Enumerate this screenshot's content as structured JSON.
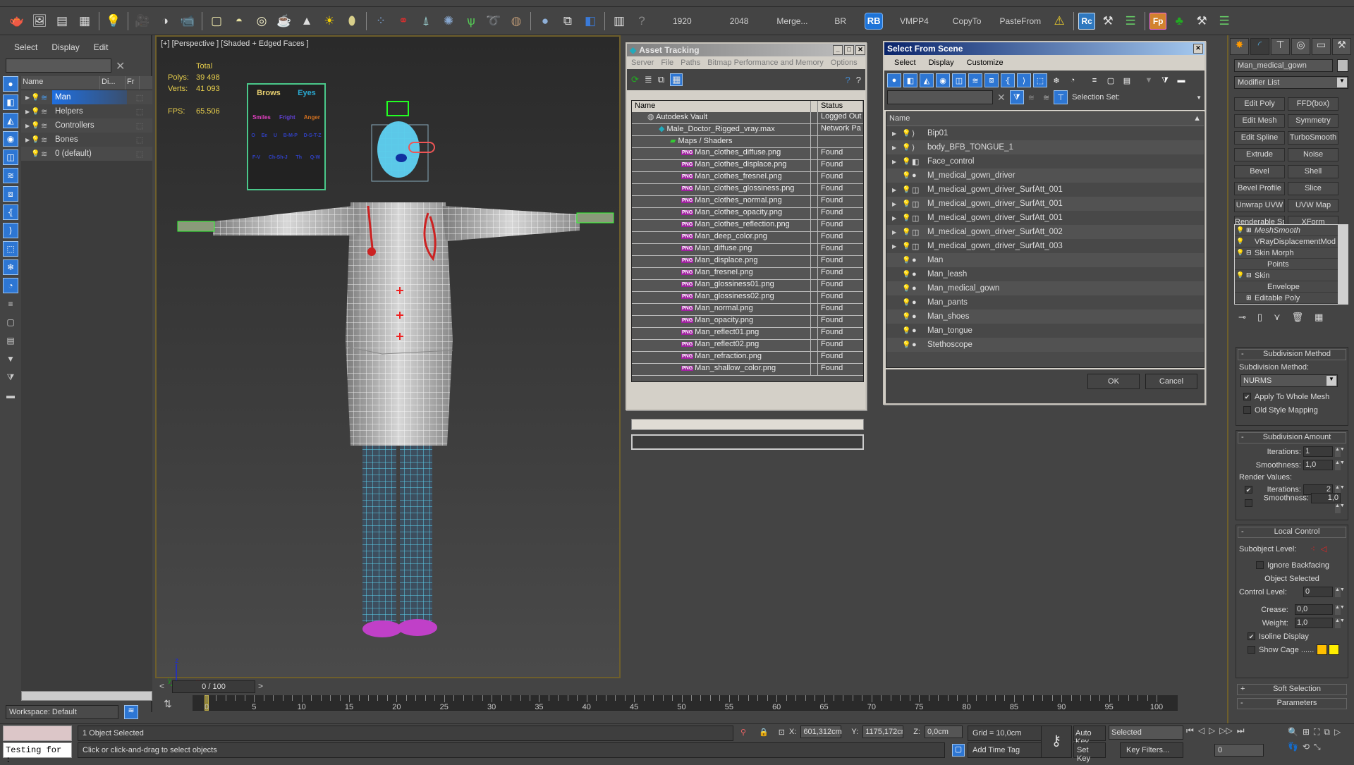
{
  "toolbar": {
    "labels": [
      "1920",
      "2048",
      "Merge...",
      "BR",
      "RB",
      "VMPP4",
      "CopyTo",
      "PasteFrom"
    ],
    "rc_label": "Rc",
    "fp_label": "Fp",
    "icons": [
      "teapot-icon",
      "render-frame-icon",
      "render-setup-icon",
      "scene-list-icon",
      "light-lister-icon",
      "camera-icon",
      "camera-target-icon",
      "camera-multi-icon",
      "box-icon",
      "dome-icon",
      "sphere-light-icon",
      "teapot-wire-icon",
      "cone-icon",
      "sun-icon",
      "ellipse-icon",
      "particles-icon",
      "molecule-icon",
      "rig-icon",
      "fractal-icon",
      "grass-icon",
      "hair-fur-icon",
      "ox-icon",
      "material-sphere-icon",
      "select-material-icon",
      "render-region-icon",
      "layer-icon",
      "help-icon"
    ]
  },
  "scene_explorer": {
    "menu": [
      "Select",
      "Display",
      "Edit"
    ],
    "columns": [
      "Name",
      "Di...",
      "Fr"
    ],
    "rows": [
      {
        "name": "Man",
        "selected": true,
        "expandable": true
      },
      {
        "name": "Helpers",
        "selected": false,
        "expandable": true
      },
      {
        "name": "Controllers",
        "selected": false,
        "expandable": true
      },
      {
        "name": "Bones",
        "selected": false,
        "expandable": true
      },
      {
        "name": "0 (default)",
        "selected": false,
        "expandable": false
      }
    ],
    "workspace": "Workspace: Default"
  },
  "viewport": {
    "label": "[+] [Perspective ] [Shaded + Edged Faces ]",
    "stats_header": "Total",
    "polys_label": "Polys:",
    "polys": "39 498",
    "verts_label": "Verts:",
    "verts": "41 093",
    "fps_label": "FPS:",
    "fps": "65.506",
    "face_controls": {
      "row1": [
        "Brows",
        "Eyes"
      ],
      "row2": [
        "Smiles",
        "Fright",
        "Anger"
      ],
      "row3": [
        "O",
        "Ee",
        "U",
        "B-M-P",
        "D-S-T-Z"
      ],
      "row4": [
        "F-V",
        "Ch-Sh-J",
        "Th",
        "Q-W"
      ]
    },
    "axis_labels": [
      "z",
      "y",
      "x"
    ]
  },
  "timeline": {
    "current": "0 / 100",
    "prev": "<",
    "next": ">",
    "ticks": [
      "0",
      "5",
      "10",
      "15",
      "20",
      "25",
      "30",
      "35",
      "40",
      "45",
      "50",
      "55",
      "60",
      "65",
      "70",
      "75",
      "80",
      "85",
      "90",
      "95",
      "100"
    ]
  },
  "status": {
    "maxscript_input": "Testing for :",
    "selection": "1 Object Selected",
    "prompt": "Click or click-and-drag to select objects",
    "x_label": "X:",
    "x": "601,312cm",
    "y_label": "Y:",
    "y": "1175,172cm",
    "z_label": "Z:",
    "z": "0,0cm",
    "grid": "Grid = 10,0cm",
    "add_time_tag": "Add Time Tag",
    "auto_key": "Auto Key",
    "set_key": "Set Key",
    "key_mode": "Selected",
    "key_filters": "Key Filters...",
    "frame": "0"
  },
  "asset_tracking": {
    "title": "Asset Tracking",
    "menu": [
      "Server",
      "File",
      "Paths",
      "Bitmap Performance and Memory",
      "Options"
    ],
    "columns": [
      "Name",
      "Status"
    ],
    "rows": [
      {
        "name": "Autodesk Vault",
        "status": "Logged Out",
        "level": 0,
        "type": "vault"
      },
      {
        "name": "Male_Doctor_Rigged_vray.max",
        "status": "Network Pa",
        "level": 1,
        "type": "max"
      },
      {
        "name": "Maps / Shaders",
        "status": "",
        "level": 2,
        "type": "folder"
      },
      {
        "name": "Man_clothes_diffuse.png",
        "status": "Found",
        "level": 3,
        "type": "png"
      },
      {
        "name": "Man_clothes_displace.png",
        "status": "Found",
        "level": 3,
        "type": "png"
      },
      {
        "name": "Man_clothes_fresneI.png",
        "status": "Found",
        "level": 3,
        "type": "png"
      },
      {
        "name": "Man_clothes_glossiness.png",
        "status": "Found",
        "level": 3,
        "type": "png"
      },
      {
        "name": "Man_clothes_normal.png",
        "status": "Found",
        "level": 3,
        "type": "png"
      },
      {
        "name": "Man_clothes_opacity.png",
        "status": "Found",
        "level": 3,
        "type": "png"
      },
      {
        "name": "Man_clothes_reflection.png",
        "status": "Found",
        "level": 3,
        "type": "png"
      },
      {
        "name": "Man_deep_color.png",
        "status": "Found",
        "level": 3,
        "type": "png"
      },
      {
        "name": "Man_diffuse.png",
        "status": "Found",
        "level": 3,
        "type": "png"
      },
      {
        "name": "Man_displace.png",
        "status": "Found",
        "level": 3,
        "type": "png"
      },
      {
        "name": "Man_fresneI.png",
        "status": "Found",
        "level": 3,
        "type": "png"
      },
      {
        "name": "Man_glossiness01.png",
        "status": "Found",
        "level": 3,
        "type": "png"
      },
      {
        "name": "Man_glossiness02.png",
        "status": "Found",
        "level": 3,
        "type": "png"
      },
      {
        "name": "Man_normal.png",
        "status": "Found",
        "level": 3,
        "type": "png"
      },
      {
        "name": "Man_opacity.png",
        "status": "Found",
        "level": 3,
        "type": "png"
      },
      {
        "name": "Man_reflect01.png",
        "status": "Found",
        "level": 3,
        "type": "png"
      },
      {
        "name": "Man_reflect02.png",
        "status": "Found",
        "level": 3,
        "type": "png"
      },
      {
        "name": "Man_refraction.png",
        "status": "Found",
        "level": 3,
        "type": "png"
      },
      {
        "name": "Man_shallow_color.png",
        "status": "Found",
        "level": 3,
        "type": "png"
      }
    ]
  },
  "select_from_scene": {
    "title": "Select From Scene",
    "menu": [
      "Select",
      "Display",
      "Customize"
    ],
    "selection_set_label": "Selection Set:",
    "column": "Name",
    "rows": [
      {
        "name": "Bip01",
        "type": "bone",
        "expandable": true
      },
      {
        "name": "body_BFB_TONGUE_1",
        "type": "bone",
        "expandable": true
      },
      {
        "name": "Face_control",
        "type": "shape",
        "expandable": true
      },
      {
        "name": "M_medical_gown_driver",
        "type": "geometry",
        "expandable": false
      },
      {
        "name": "M_medical_gown_driver_SurfAtt_001",
        "type": "helper",
        "expandable": true
      },
      {
        "name": "M_medical_gown_driver_SurfAtt_001",
        "type": "helper",
        "expandable": true
      },
      {
        "name": "M_medical_gown_driver_SurfAtt_001",
        "type": "helper",
        "expandable": true
      },
      {
        "name": "M_medical_gown_driver_SurfAtt_002",
        "type": "helper",
        "expandable": true
      },
      {
        "name": "M_medical_gown_driver_SurfAtt_003",
        "type": "helper",
        "expandable": true
      },
      {
        "name": "Man",
        "type": "geometry",
        "expandable": false
      },
      {
        "name": "Man_leash",
        "type": "geometry",
        "expandable": false
      },
      {
        "name": "Man_medical_gown",
        "type": "geometry",
        "expandable": false
      },
      {
        "name": "Man_pants",
        "type": "geometry",
        "expandable": false
      },
      {
        "name": "Man_shoes",
        "type": "geometry",
        "expandable": false
      },
      {
        "name": "Man_tongue",
        "type": "geometry",
        "expandable": false
      },
      {
        "name": "Stethoscope",
        "type": "geometry",
        "expandable": false
      }
    ],
    "ok": "OK",
    "cancel": "Cancel"
  },
  "command_panel": {
    "object_name": "Man_medical_gown",
    "modifier_list": "Modifier List",
    "modifier_buttons": [
      "Edit Poly",
      "FFD(box)",
      "Edit Mesh",
      "Symmetry",
      "Edit Spline",
      "TurboSmooth",
      "Extrude",
      "Noise",
      "Bevel",
      "Shell",
      "Bevel Profile",
      "Slice",
      "Unwrap UVW",
      "UVW Map",
      "Renderable Spline",
      "XForm"
    ],
    "stack": [
      {
        "label": "MeshSmooth",
        "italic": true,
        "pm": "+",
        "eye": true,
        "indent": 0
      },
      {
        "label": "VRayDisplacementMod",
        "italic": false,
        "pm": "",
        "eye": true,
        "indent": 0
      },
      {
        "label": "Skin Morph",
        "italic": false,
        "pm": "−",
        "eye": true,
        "indent": 0
      },
      {
        "label": "Points",
        "italic": false,
        "pm": "",
        "eye": false,
        "indent": 1
      },
      {
        "label": "Skin",
        "italic": false,
        "pm": "−",
        "eye": true,
        "indent": 0
      },
      {
        "label": "Envelope",
        "italic": false,
        "pm": "",
        "eye": false,
        "indent": 1
      },
      {
        "label": "Editable Poly",
        "italic": false,
        "pm": "+",
        "eye": false,
        "indent": 0
      }
    ],
    "subdivision_method": {
      "title": "Subdivision Method",
      "label": "Subdivision Method:",
      "value": "NURMS",
      "apply_whole_mesh": "Apply To Whole Mesh",
      "apply_whole_mesh_checked": true,
      "old_style_mapping": "Old Style Mapping",
      "old_style_mapping_checked": false
    },
    "subdivision_amount": {
      "title": "Subdivision Amount",
      "iterations_label": "Iterations:",
      "iterations": "1",
      "smoothness_label": "Smoothness:",
      "smoothness": "1,0",
      "render_values_label": "Render Values:",
      "render_iterations_checked": true,
      "render_iterations": "2",
      "render_smoothness_checked": false,
      "render_smoothness": "1,0"
    },
    "local_control": {
      "title": "Local Control",
      "subobject_label": "Subobject Level:",
      "ignore_backfacing": "Ignore Backfacing",
      "ignore_backfacing_checked": false,
      "object_selected": "Object Selected",
      "control_level_label": "Control Level:",
      "control_level": "0",
      "crease_label": "Crease:",
      "crease": "0,0",
      "weight_label": "Weight:",
      "weight": "1,0",
      "isoline": "Isoline Display",
      "isoline_checked": true,
      "show_cage": "Show Cage ......",
      "show_cage_checked": false,
      "cage_color_1": "#ffc000",
      "cage_color_2": "#ffee00"
    },
    "soft_selection": "Soft Selection",
    "parameters": "Parameters"
  }
}
